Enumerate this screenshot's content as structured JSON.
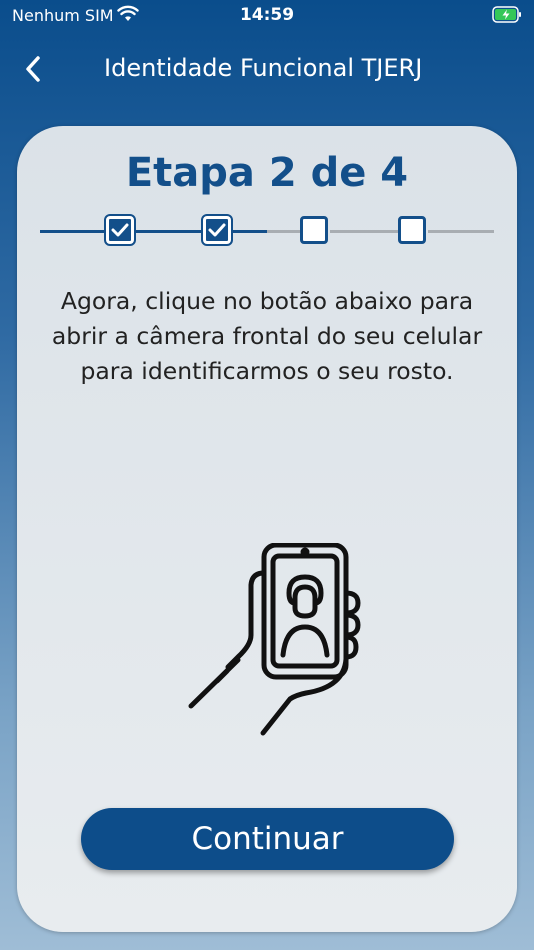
{
  "status": {
    "carrier": "Nenhum SIM",
    "time": "14:59"
  },
  "nav": {
    "title": "Identidade Funcional TJERJ",
    "back_icon": "chevron-left"
  },
  "step": {
    "title": "Etapa 2 de 4",
    "current": 2,
    "total": 4,
    "completed": [
      true,
      true,
      false,
      false
    ]
  },
  "instruction": "Agora, clique no botão abaixo para abrir a câmera frontal do seu celular para identificarmos o seu rosto.",
  "illustration_icon": "hand-holding-phone-selfie",
  "button": {
    "label": "Continuar"
  },
  "colors": {
    "primary": "#134f8a",
    "button": "#0d4d8a",
    "inactive_line": "#a8adb2"
  }
}
